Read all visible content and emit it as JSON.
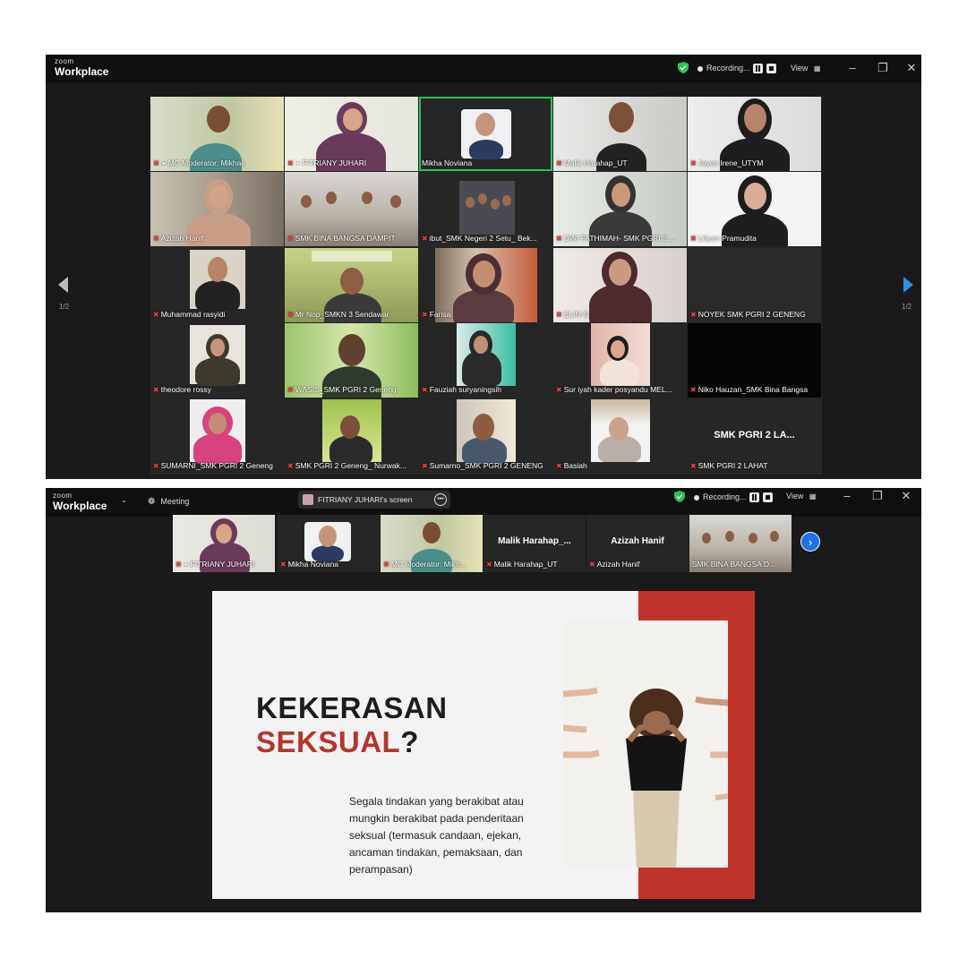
{
  "app": {
    "logo_top": "zoom",
    "logo_bottom": "Workplace"
  },
  "top_window": {
    "recording_label": "Recording...",
    "view_label": "View",
    "page_left": "1/2",
    "page_right": "1/2",
    "participants": [
      {
        "name": "MC Moderator: Mikhail",
        "muted": true,
        "pinned": true
      },
      {
        "name": "FITRIANY JUHARI",
        "muted": true,
        "pinned": true
      },
      {
        "name": "Mikha Noviana",
        "muted": false,
        "active_speaker": true
      },
      {
        "name": "Malik Harahap_UT",
        "muted": true
      },
      {
        "name": "Joyce Irene_UTYM",
        "muted": true
      },
      {
        "name": "Azizah Hanif",
        "muted": true
      },
      {
        "name": "SMK BINA BANGSA DAMPIT",
        "muted": true
      },
      {
        "name": "ibut_SMK Negeri 2 Setu_ Bek...",
        "muted": true
      },
      {
        "name": "DWI FATHIMAH- SMK PGRI 2 ...",
        "muted": true
      },
      {
        "name": "Liliyan Pramudita",
        "muted": true
      },
      {
        "name": "Muhammad rasyidi",
        "muted": true
      },
      {
        "name": "Mr Nop_SMKN 3 Sendawar",
        "muted": true
      },
      {
        "name": "Farisa",
        "muted": true
      },
      {
        "name": "ELIN-S",
        "muted": true
      },
      {
        "name": "NOYEK SMK PGRI 2 GENENG",
        "muted": true
      },
      {
        "name": "theodore rossy",
        "muted": true
      },
      {
        "name": "WASIS_SMK PGRI 2 Geneng",
        "muted": true
      },
      {
        "name": "Fauziah suryaningsih",
        "muted": true
      },
      {
        "name": "Sur iyah kader posyandu MEL...",
        "muted": true
      },
      {
        "name": "Niko Hauzan_SMK Bina Bangsa",
        "muted": true
      },
      {
        "name": "SUMARNI_SMK PGRI 2 Geneng",
        "muted": true
      },
      {
        "name": "SMK PGRI 2 Geneng_ Nurwak...",
        "muted": true
      },
      {
        "name": "Sumarno_SMK PGRI 2 GENENG",
        "muted": true
      },
      {
        "name": "Basiah",
        "muted": true
      },
      {
        "name": "SMK PGRI 2 LAHAT",
        "muted": true,
        "video_off_label": "SMK PGRI 2 LA..."
      }
    ]
  },
  "bottom_window": {
    "meeting_label": "Meeting",
    "share_tab_label": "FITRIANY JUHARI's screen",
    "recording_label": "Recording...",
    "view_label": "View",
    "strip": [
      {
        "name": "FITRIANY JUHARI",
        "muted": true,
        "pinned": true
      },
      {
        "name": "Mikha Noviana",
        "muted": true
      },
      {
        "name": "MC Moderator: Mikh...",
        "muted": true
      },
      {
        "name": "Malik Harahap_UT",
        "muted": true,
        "video_off_label": "Malik  Harahap_..."
      },
      {
        "name": "Azizah Hanif",
        "muted": true,
        "video_off_label": "Azizah Hanif"
      },
      {
        "name": "SMK BINA BANGSA D...",
        "muted": true
      }
    ],
    "slide": {
      "title_line1": "KEKERASAN",
      "title_line2_red": "SEKSUAL",
      "title_line2_rest": "?",
      "body": "Segala tindakan yang berakibat atau mungkin berakibat pada penderitaan seksual (termasuk candaan, ejekan, ancaman tindakan, pemaksaan, dan perampasan)"
    }
  },
  "colors": {
    "accent_green": "#2bc25a",
    "mute_red": "#e0453c",
    "nav_blue": "#1e74e6",
    "slide_red": "#c0332a"
  }
}
